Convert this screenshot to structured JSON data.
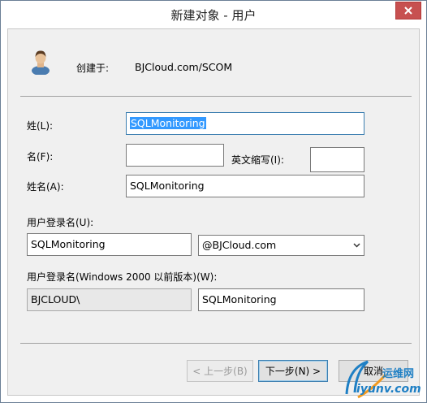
{
  "window": {
    "title": "新建对象 - 用户"
  },
  "header": {
    "created_in_label": "创建于:",
    "created_in_value": "BJCloud.com/SCOM"
  },
  "form": {
    "last_name_label": "姓(L):",
    "last_name_value": "SQLMonitoring",
    "first_name_label": "名(F):",
    "first_name_value": "",
    "initials_label": "英文缩写(I):",
    "initials_value": "",
    "full_name_label": "姓名(A):",
    "full_name_value": "SQLMonitoring",
    "logon_name_label": "用户登录名(U):",
    "logon_name_value": "SQLMonitoring",
    "upn_suffix_value": "@BJCloud.com",
    "legacy_logon_label": "用户登录名(Windows 2000 以前版本)(W):",
    "domain_prefix_value": "BJCLOUD\\",
    "legacy_logon_value": "SQLMonitoring"
  },
  "buttons": {
    "back": "< 上一步(B)",
    "next": "下一步(N) >",
    "cancel": "取消"
  },
  "watermark": {
    "text1": "运维网",
    "text2": "iyunv.com"
  },
  "icons": {
    "user": "user-icon",
    "close": "close-icon",
    "dropdown": "chevron-down-icon"
  },
  "colors": {
    "selection": "#3399ff",
    "close_button": "#c75050",
    "focus_border": "#3c7fb1"
  }
}
